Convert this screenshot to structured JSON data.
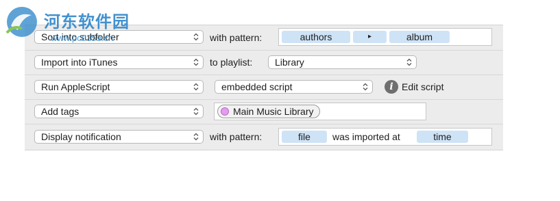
{
  "rows": [
    {
      "action": "Sort into subfolder",
      "connector": "with pattern:",
      "tokens": [
        "authors",
        "▸",
        "album"
      ]
    },
    {
      "action": "Import into iTunes",
      "connector": "to playlist:",
      "value": "Library"
    },
    {
      "action": "Run AppleScript",
      "value": "embedded script",
      "link": "Edit script"
    },
    {
      "action": "Add tags",
      "tag": "Main Music Library"
    },
    {
      "action": "Display notification",
      "connector": "with pattern:",
      "tokens": [
        "file",
        "time"
      ],
      "middle_text": "was imported at"
    }
  ],
  "watermark": {
    "title": "河东软件园",
    "url": "www.pc0359.cn"
  },
  "icons": {
    "info": "i"
  },
  "colors": {
    "token_bg": "#cfe3f6",
    "tag_color": "#e59bf0",
    "panel_bg": "#ececec"
  }
}
